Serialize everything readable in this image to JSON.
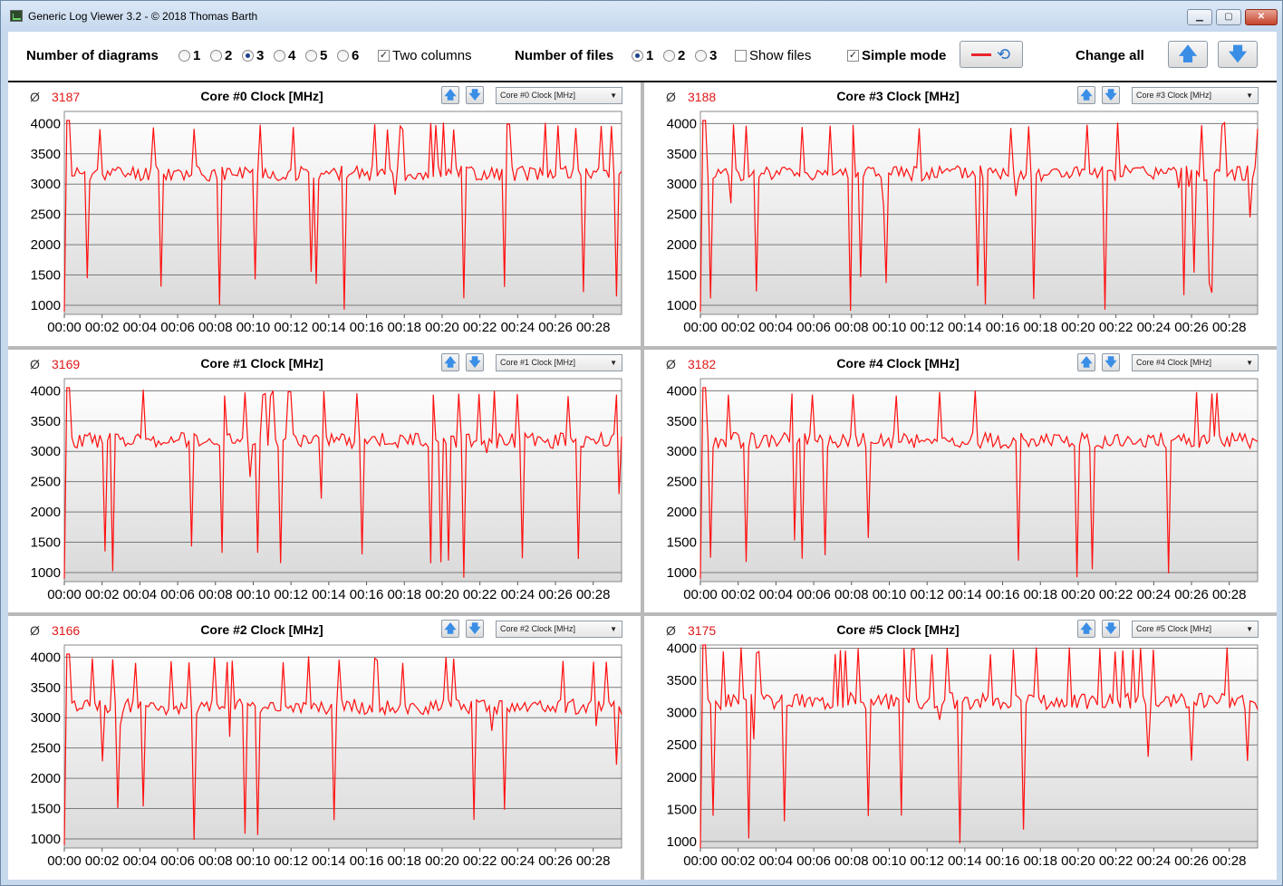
{
  "window": {
    "title": "Generic Log Viewer 3.2 - © 2018 Thomas Barth",
    "min_label": "▁",
    "max_label": "▢",
    "close_label": "✕"
  },
  "toolbar": {
    "diagrams_label": "Number of diagrams",
    "diagram_options": [
      "1",
      "2",
      "3",
      "4",
      "5",
      "6"
    ],
    "diagram_selected": "3",
    "two_columns_label": "Two columns",
    "two_columns_checked": true,
    "files_label": "Number of files",
    "file_options": [
      "1",
      "2",
      "3"
    ],
    "file_selected": "1",
    "show_files_label": "Show files",
    "show_files_checked": false,
    "simple_mode_label": "Simple mode",
    "simple_mode_checked": true,
    "change_all_label": "Change all",
    "check_mark": "✓"
  },
  "icons": {
    "up": "🡅",
    "down": "🡇",
    "refresh": "⟲"
  },
  "colors": {
    "series": "#ff1010",
    "average": "#e01818"
  },
  "chart_data": [
    {
      "type": "line",
      "avg_symbol": "Ø",
      "average": "3187",
      "title": "Core #0 Clock [MHz]",
      "select": "Core #0 Clock [MHz]",
      "yticks": [
        1000,
        1500,
        2000,
        2500,
        3000,
        3500,
        4000
      ],
      "ylim": [
        850,
        4200
      ],
      "xlim": [
        0,
        29.5
      ],
      "xticks": [
        "00:00",
        "00:02",
        "00:04",
        "00:06",
        "00:08",
        "00:10",
        "00:12",
        "00:14",
        "00:16",
        "00:18",
        "00:20",
        "00:22",
        "00:24",
        "00:26",
        "00:28"
      ],
      "seed": 11
    },
    {
      "type": "line",
      "avg_symbol": "Ø",
      "average": "3169",
      "title": "Core #1 Clock [MHz]",
      "select": "Core #1 Clock [MHz]",
      "yticks": [
        1000,
        1500,
        2000,
        2500,
        3000,
        3500,
        4000
      ],
      "ylim": [
        850,
        4200
      ],
      "xlim": [
        0,
        29.5
      ],
      "xticks": [
        "00:00",
        "00:02",
        "00:04",
        "00:06",
        "00:08",
        "00:10",
        "00:12",
        "00:14",
        "00:16",
        "00:18",
        "00:20",
        "00:22",
        "00:24",
        "00:26",
        "00:28"
      ],
      "seed": 23
    },
    {
      "type": "line",
      "avg_symbol": "Ø",
      "average": "3166",
      "title": "Core #2 Clock [MHz]",
      "select": "Core #2 Clock [MHz]",
      "yticks": [
        1000,
        1500,
        2000,
        2500,
        3000,
        3500,
        4000
      ],
      "ylim": [
        850,
        4200
      ],
      "xlim": [
        0,
        29.5
      ],
      "xticks": [
        "00:00",
        "00:02",
        "00:04",
        "00:06",
        "00:08",
        "00:10",
        "00:12",
        "00:14",
        "00:16",
        "00:18",
        "00:20",
        "00:22",
        "00:24",
        "00:26",
        "00:28"
      ],
      "seed": 37
    },
    {
      "type": "line",
      "avg_symbol": "Ø",
      "average": "3188",
      "title": "Core #3 Clock [MHz]",
      "select": "Core #3 Clock [MHz]",
      "yticks": [
        1000,
        1500,
        2000,
        2500,
        3000,
        3500,
        4000
      ],
      "ylim": [
        850,
        4200
      ],
      "xlim": [
        0,
        29.5
      ],
      "xticks": [
        "00:00",
        "00:02",
        "00:04",
        "00:06",
        "00:08",
        "00:10",
        "00:12",
        "00:14",
        "00:16",
        "00:18",
        "00:20",
        "00:22",
        "00:24",
        "00:26",
        "00:28"
      ],
      "seed": 41
    },
    {
      "type": "line",
      "avg_symbol": "Ø",
      "average": "3182",
      "title": "Core #4 Clock [MHz]",
      "select": "Core #4 Clock [MHz]",
      "yticks": [
        1000,
        1500,
        2000,
        2500,
        3000,
        3500,
        4000
      ],
      "ylim": [
        850,
        4200
      ],
      "xlim": [
        0,
        29.5
      ],
      "xticks": [
        "00:00",
        "00:02",
        "00:04",
        "00:06",
        "00:08",
        "00:10",
        "00:12",
        "00:14",
        "00:16",
        "00:18",
        "00:20",
        "00:22",
        "00:24",
        "00:26",
        "00:28"
      ],
      "seed": 53
    },
    {
      "type": "line",
      "avg_symbol": "Ø",
      "average": "3175",
      "title": "Core #5 Clock [MHz]",
      "select": "Core #5 Clock [MHz]",
      "yticks": [
        1000,
        1500,
        2000,
        2500,
        3000,
        3500,
        4000
      ],
      "ylim": [
        900,
        4050
      ],
      "xlim": [
        0,
        29.5
      ],
      "xticks": [
        "00:00",
        "00:02",
        "00:04",
        "00:06",
        "00:08",
        "00:10",
        "00:12",
        "00:14",
        "00:16",
        "00:18",
        "00:20",
        "00:22",
        "00:24",
        "00:26",
        "00:28"
      ],
      "seed": 67
    }
  ]
}
